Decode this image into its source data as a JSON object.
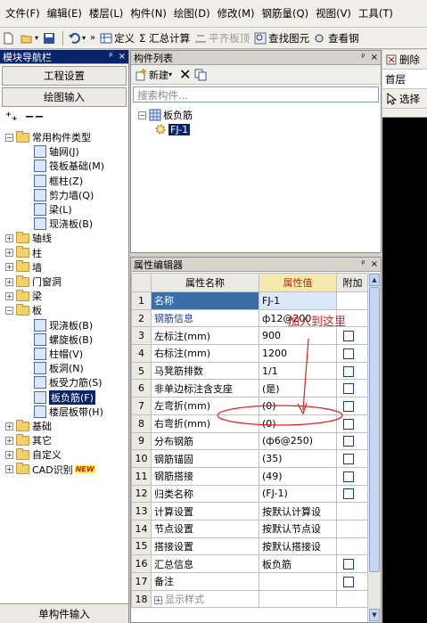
{
  "menu": [
    "文件(F)",
    "编辑(E)",
    "楼层(L)",
    "构件(N)",
    "绘图(D)",
    "修改(M)",
    "钢筋量(Q)",
    "视图(V)",
    "工具(T)"
  ],
  "toolbar": {
    "define": "定义",
    "sum": "Σ 汇总计算",
    "level": "平齐板顶",
    "find": "查找图元",
    "view": "查看钢"
  },
  "nav": {
    "title": "模块导航栏",
    "pin": "ᵖ",
    "close": "×",
    "settings_btn": "工程设置",
    "draw_btn": "绘图输入",
    "bottom_btn": "单构件输入",
    "tree": [
      {
        "label": "常用构件类型",
        "level": 0,
        "type": "folder",
        "pm": "−"
      },
      {
        "label": "轴网(J)",
        "level": 1,
        "type": "icon"
      },
      {
        "label": "筏板基础(M)",
        "level": 1,
        "type": "icon"
      },
      {
        "label": "框柱(Z)",
        "level": 1,
        "type": "icon"
      },
      {
        "label": "剪力墙(Q)",
        "level": 1,
        "type": "icon"
      },
      {
        "label": "梁(L)",
        "level": 1,
        "type": "icon"
      },
      {
        "label": "现浇板(B)",
        "level": 1,
        "type": "icon"
      },
      {
        "label": "轴线",
        "level": 0,
        "type": "folder",
        "pm": "+"
      },
      {
        "label": "柱",
        "level": 0,
        "type": "folder",
        "pm": "+"
      },
      {
        "label": "墙",
        "level": 0,
        "type": "folder",
        "pm": "+"
      },
      {
        "label": "门窗洞",
        "level": 0,
        "type": "folder",
        "pm": "+"
      },
      {
        "label": "梁",
        "level": 0,
        "type": "folder",
        "pm": "+"
      },
      {
        "label": "板",
        "level": 0,
        "type": "folder",
        "pm": "−"
      },
      {
        "label": "现浇板(B)",
        "level": 1,
        "type": "icon"
      },
      {
        "label": "螺旋板(B)",
        "level": 1,
        "type": "icon"
      },
      {
        "label": "柱帽(V)",
        "level": 1,
        "type": "icon"
      },
      {
        "label": "板洞(N)",
        "level": 1,
        "type": "icon"
      },
      {
        "label": "板受力筋(S)",
        "level": 1,
        "type": "icon"
      },
      {
        "label": "板负筋(F)",
        "level": 1,
        "type": "icon",
        "selected": true
      },
      {
        "label": "楼层板带(H)",
        "level": 1,
        "type": "icon"
      },
      {
        "label": "基础",
        "level": 0,
        "type": "folder",
        "pm": "+"
      },
      {
        "label": "其它",
        "level": 0,
        "type": "folder",
        "pm": "+"
      },
      {
        "label": "自定义",
        "level": 0,
        "type": "folder",
        "pm": "+"
      },
      {
        "label": "CAD识别",
        "level": 0,
        "type": "folder",
        "pm": "+",
        "badge": "NEW"
      }
    ]
  },
  "complist": {
    "title": "构件列表",
    "new_btn": "新建",
    "search_placeholder": "搜索构件...",
    "root": "板负筋",
    "child": "FJ-1"
  },
  "props": {
    "title": "属性编辑器",
    "col_name": "属性名称",
    "col_value": "属性值",
    "col_add": "附加",
    "rows": [
      {
        "n": "1",
        "name": "名称",
        "value": "FJ-1",
        "cb": false,
        "style": "sel"
      },
      {
        "n": "2",
        "name": "钢筋信息",
        "value": "ф12@200",
        "cb": false,
        "style": "blue"
      },
      {
        "n": "3",
        "name": "左标注(mm)",
        "value": "900",
        "cb": true
      },
      {
        "n": "4",
        "name": "右标注(mm)",
        "value": "1200",
        "cb": true
      },
      {
        "n": "5",
        "name": "马凳筋排数",
        "value": "1/1",
        "cb": true
      },
      {
        "n": "6",
        "name": "非单边标注含支座",
        "value": "(是)",
        "cb": true
      },
      {
        "n": "7",
        "name": "左弯折(mm)",
        "value": "(0)",
        "cb": true
      },
      {
        "n": "8",
        "name": "右弯折(mm)",
        "value": "(0)",
        "cb": true
      },
      {
        "n": "9",
        "name": "分布钢筋",
        "value": "(ф6@250)",
        "cb": true
      },
      {
        "n": "10",
        "name": "钢筋锚固",
        "value": "(35)",
        "cb": true
      },
      {
        "n": "11",
        "name": "钢筋搭接",
        "value": "(49)",
        "cb": true
      },
      {
        "n": "12",
        "name": "归类名称",
        "value": "(FJ-1)",
        "cb": true
      },
      {
        "n": "13",
        "name": "计算设置",
        "value": "按默认计算设",
        "cb": false
      },
      {
        "n": "14",
        "name": "节点设置",
        "value": "按默认节点设",
        "cb": false
      },
      {
        "n": "15",
        "name": "搭接设置",
        "value": "按默认搭接设",
        "cb": false
      },
      {
        "n": "16",
        "name": "汇总信息",
        "value": "板负筋",
        "cb": true
      },
      {
        "n": "17",
        "name": "备注",
        "value": "",
        "cb": true
      },
      {
        "n": "18",
        "name": "显示样式",
        "value": "",
        "cb": false,
        "expand": "+"
      }
    ]
  },
  "right": {
    "delete": "删除",
    "floor": "首层",
    "select": "选择"
  },
  "annotation": {
    "text": "加入到这里",
    "color": "#e02020"
  }
}
